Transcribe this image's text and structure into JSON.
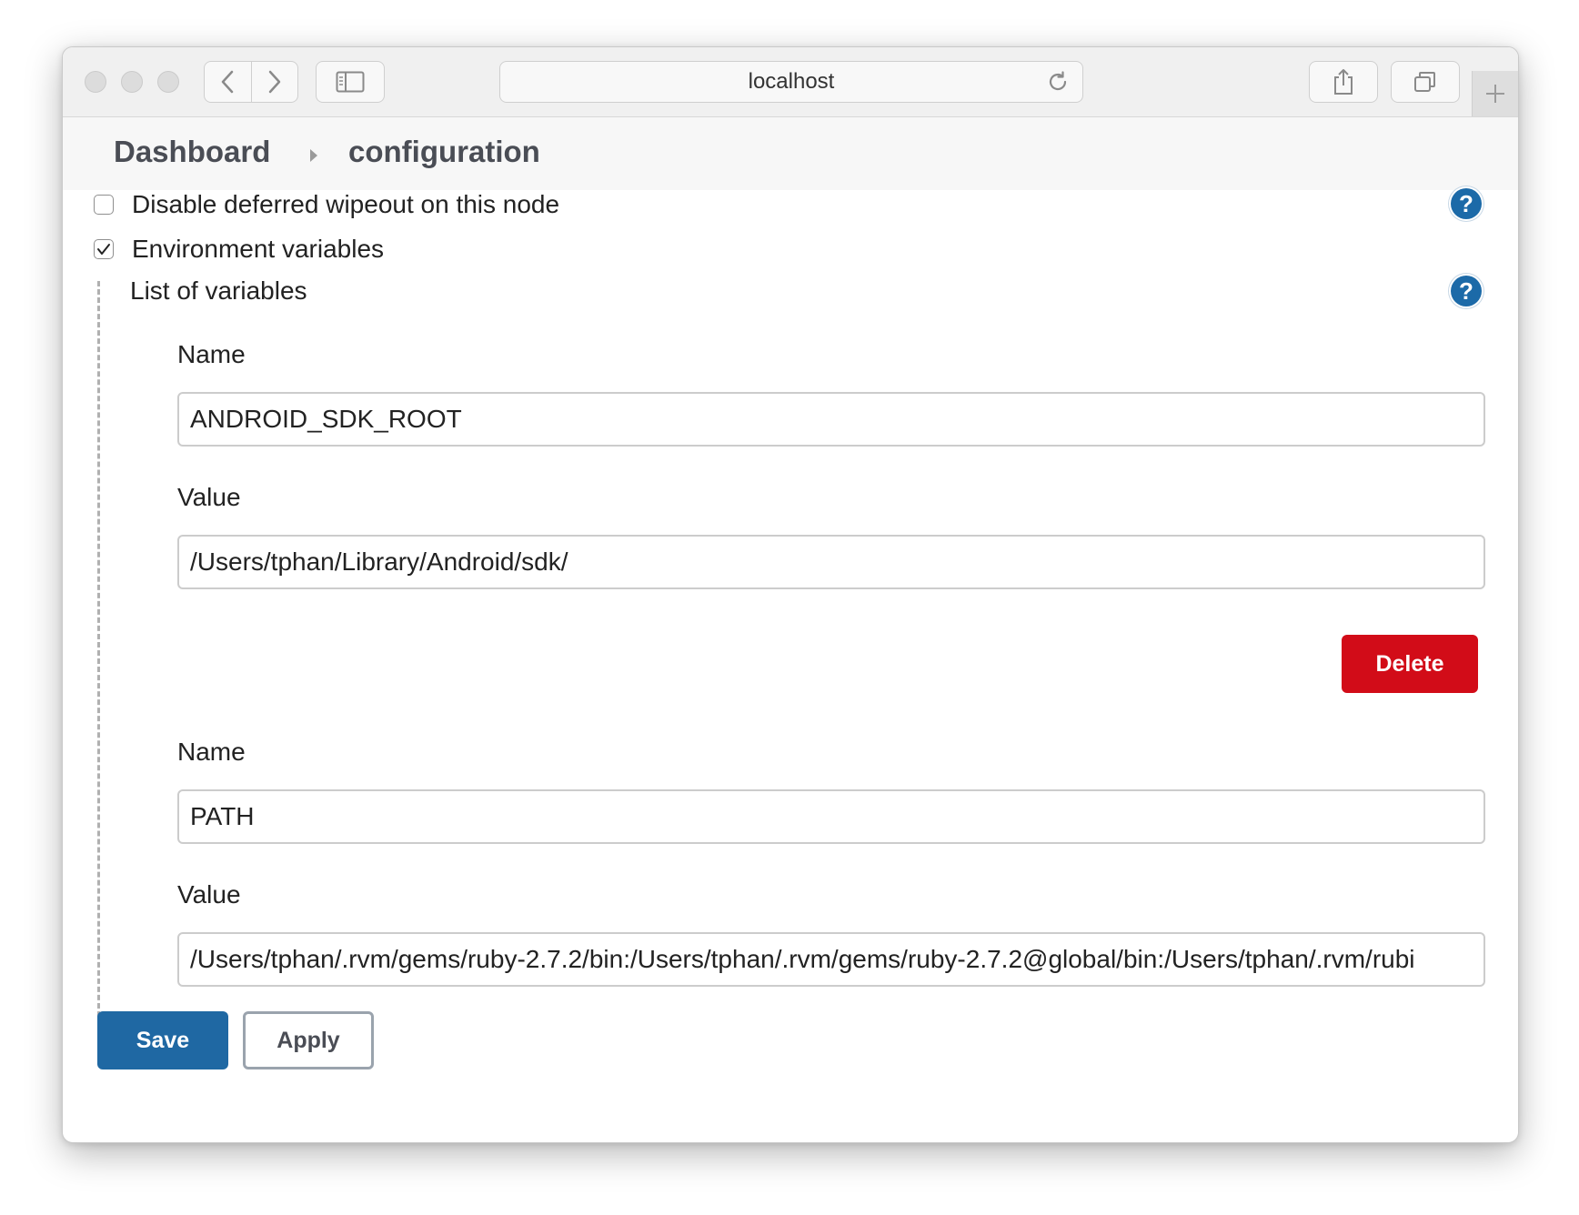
{
  "browser": {
    "address": "localhost",
    "icons": {
      "back": "chevron-left-icon",
      "forward": "chevron-right-icon",
      "sidebar": "sidebar-icon",
      "reload": "reload-icon",
      "share": "share-icon",
      "tabs": "tabs-icon",
      "new_tab": "plus-icon"
    }
  },
  "breadcrumb": {
    "items": [
      "Dashboard",
      "configuration"
    ]
  },
  "options": {
    "disable_wipeout": {
      "label": "Disable deferred wipeout on this node",
      "checked": false
    },
    "env_vars": {
      "label": "Environment variables",
      "checked": true
    }
  },
  "env": {
    "list_title": "List of variables",
    "help_glyph": "?",
    "variables": [
      {
        "name_label": "Name",
        "name": "ANDROID_SDK_ROOT",
        "value_label": "Value",
        "value": "/Users/tphan/Library/Android/sdk/"
      },
      {
        "name_label": "Name",
        "name": "PATH",
        "value_label": "Value",
        "value": "/Users/tphan/.rvm/gems/ruby-2.7.2/bin:/Users/tphan/.rvm/gems/ruby-2.7.2@global/bin:/Users/tphan/.rvm/rubi"
      }
    ],
    "delete_label": "Delete"
  },
  "actions": {
    "save_label": "Save",
    "apply_label": "Apply"
  },
  "colors": {
    "accent": "#1f68a3",
    "danger": "#d20c18",
    "help": "#1c6aa8"
  }
}
